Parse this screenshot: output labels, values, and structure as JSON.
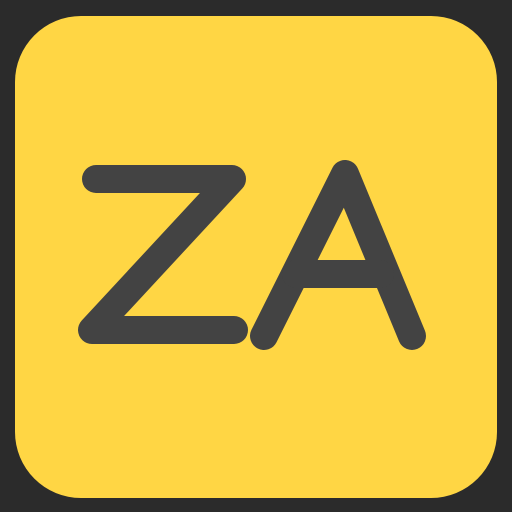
{
  "icon": {
    "label": "ZA",
    "colors": {
      "background": "#2b2b2b",
      "tile": "#ffd644",
      "glyph": "#434343"
    }
  }
}
